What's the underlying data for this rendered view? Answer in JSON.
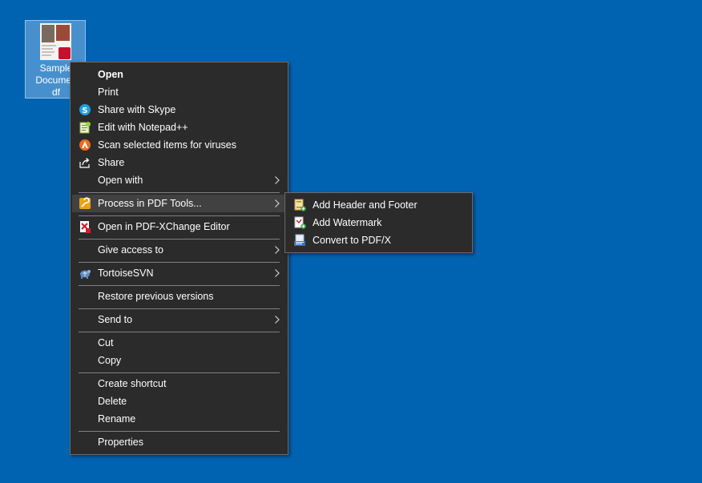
{
  "desktop": {
    "icon_label_lines": [
      "Sample",
      "Documen",
      "df"
    ]
  },
  "context_menu": {
    "items": [
      {
        "label": "Open",
        "icon": "none"
      },
      {
        "label": "Print",
        "icon": "none"
      },
      {
        "label": "Share with Skype",
        "icon": "skype-icon"
      },
      {
        "label": "Edit with Notepad++",
        "icon": "notepad-plus-plus-icon"
      },
      {
        "label": "Scan selected items for viruses",
        "icon": "antivirus-icon"
      },
      {
        "label": "Share",
        "icon": "share-icon"
      },
      {
        "label": "Open with",
        "icon": "none"
      },
      {
        "label": "Process in PDF Tools...",
        "icon": "pdf-tools-icon"
      },
      {
        "label": "Open in PDF-XChange Editor",
        "icon": "pdf-xchange-icon"
      },
      {
        "label": "Give access to",
        "icon": "none"
      },
      {
        "label": "TortoiseSVN",
        "icon": "tortoisesvn-icon"
      },
      {
        "label": "Restore previous versions",
        "icon": "none"
      },
      {
        "label": "Send to",
        "icon": "none"
      },
      {
        "label": "Cut",
        "icon": "none"
      },
      {
        "label": "Copy",
        "icon": "none"
      },
      {
        "label": "Create shortcut",
        "icon": "none"
      },
      {
        "label": "Delete",
        "icon": "none"
      },
      {
        "label": "Rename",
        "icon": "none"
      },
      {
        "label": "Properties",
        "icon": "none"
      }
    ]
  },
  "submenu": {
    "items": [
      {
        "label": "Add Header and Footer",
        "icon": "add-header-footer-icon"
      },
      {
        "label": "Add Watermark",
        "icon": "add-watermark-icon"
      },
      {
        "label": "Convert to PDF/X",
        "icon": "pdfx-icon"
      }
    ]
  },
  "colors": {
    "desktop_background": "#0063b1",
    "menu_background": "#2b2b2b",
    "menu_highlight": "#414141",
    "menu_text": "#ffffff"
  }
}
